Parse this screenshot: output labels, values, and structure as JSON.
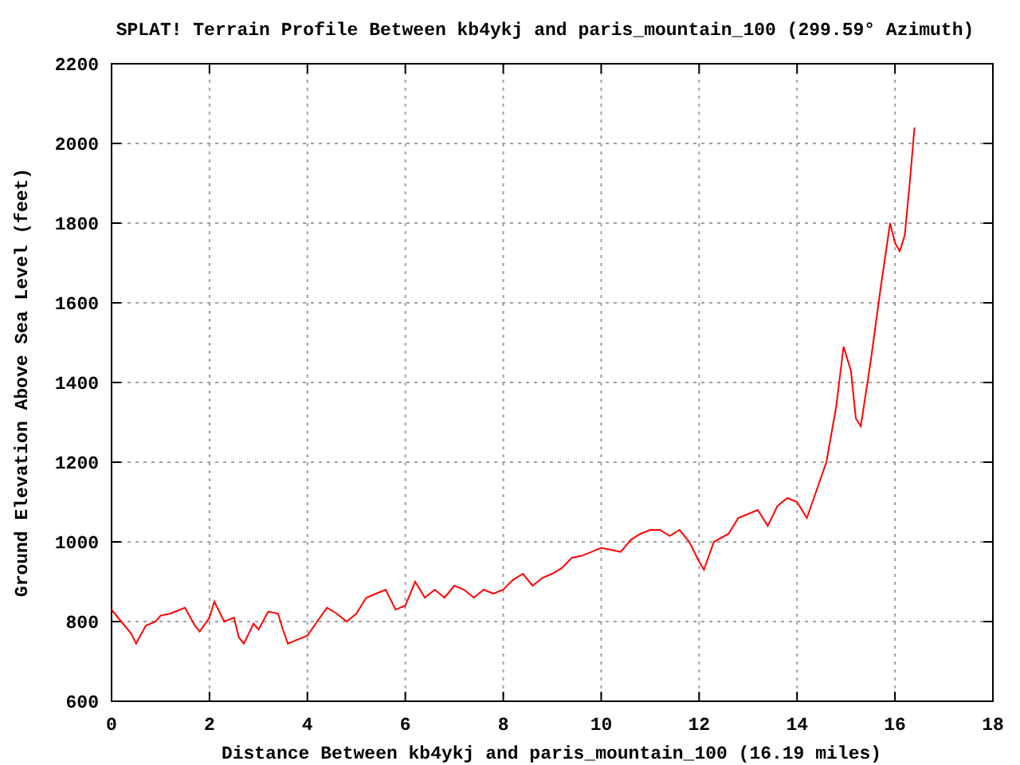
{
  "chart_data": {
    "type": "line",
    "title": "SPLAT! Terrain Profile Between kb4ykj and paris_mountain_100 (299.59° Azimuth)",
    "xlabel": "Distance Between kb4ykj and paris_mountain_100 (16.19 miles)",
    "ylabel": "Ground Elevation Above Sea Level (feet)",
    "x": [
      0,
      0.2,
      0.4,
      0.5,
      0.7,
      0.9,
      1.0,
      1.2,
      1.5,
      1.7,
      1.8,
      2.0,
      2.1,
      2.3,
      2.5,
      2.6,
      2.7,
      2.9,
      3.0,
      3.2,
      3.4,
      3.5,
      3.6,
      3.8,
      4.0,
      4.2,
      4.4,
      4.6,
      4.8,
      5.0,
      5.2,
      5.4,
      5.6,
      5.8,
      6.0,
      6.2,
      6.4,
      6.6,
      6.8,
      7.0,
      7.2,
      7.4,
      7.6,
      7.8,
      8.0,
      8.2,
      8.4,
      8.6,
      8.8,
      9.0,
      9.2,
      9.4,
      9.6,
      9.8,
      10.0,
      10.2,
      10.4,
      10.6,
      10.8,
      11.0,
      11.2,
      11.4,
      11.6,
      11.8,
      12.0,
      12.1,
      12.3,
      12.6,
      12.8,
      13.0,
      13.2,
      13.4,
      13.6,
      13.8,
      14.0,
      14.2,
      14.4,
      14.6,
      14.8,
      14.95,
      15.1,
      15.2,
      15.3,
      15.5,
      15.7,
      15.9,
      16.0,
      16.1,
      16.2,
      16.3,
      16.4
    ],
    "series": [
      {
        "color": "#ff0000",
        "values": [
          830,
          800,
          770,
          745,
          790,
          800,
          815,
          820,
          835,
          790,
          775,
          810,
          850,
          800,
          810,
          760,
          745,
          795,
          780,
          825,
          820,
          780,
          745,
          755,
          765,
          800,
          835,
          820,
          800,
          820,
          860,
          870,
          880,
          830,
          840,
          900,
          860,
          880,
          860,
          890,
          880,
          860,
          880,
          870,
          880,
          905,
          920,
          890,
          910,
          920,
          935,
          960,
          965,
          975,
          985,
          980,
          975,
          1005,
          1020,
          1030,
          1030,
          1015,
          1030,
          1000,
          950,
          930,
          1000,
          1020,
          1060,
          1070,
          1080,
          1040,
          1090,
          1110,
          1100,
          1060,
          1130,
          1200,
          1340,
          1490,
          1430,
          1310,
          1290,
          1450,
          1630,
          1800,
          1750,
          1730,
          1770,
          1900,
          2040
        ]
      }
    ],
    "xlim": [
      0,
      18
    ],
    "ylim": [
      600,
      2200
    ],
    "xticks": [
      0,
      2,
      4,
      6,
      8,
      10,
      12,
      14,
      16,
      18
    ],
    "yticks": [
      600,
      800,
      1000,
      1200,
      1400,
      1600,
      1800,
      2000,
      2200
    ],
    "grid": true
  }
}
